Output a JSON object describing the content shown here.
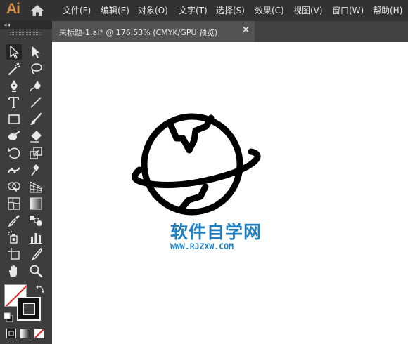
{
  "app": {
    "logo_text": "Ai",
    "brand_color": "#d48e47"
  },
  "menu": {
    "items": [
      {
        "label": "文件(F)"
      },
      {
        "label": "编辑(E)"
      },
      {
        "label": "对象(O)"
      },
      {
        "label": "文字(T)"
      },
      {
        "label": "选择(S)"
      },
      {
        "label": "效果(C)"
      },
      {
        "label": "视图(V)"
      },
      {
        "label": "窗口(W)"
      },
      {
        "label": "帮助(H)"
      }
    ]
  },
  "panel": {
    "collapse_glyph": "◂◂"
  },
  "toolbar": {
    "tools": [
      {
        "name": "selection-tool-icon",
        "active": true
      },
      {
        "name": "direct-selection-tool-icon"
      },
      {
        "name": "magic-wand-tool-icon"
      },
      {
        "name": "lasso-tool-icon"
      },
      {
        "name": "pen-tool-icon"
      },
      {
        "name": "curvature-tool-icon"
      },
      {
        "name": "type-tool-icon"
      },
      {
        "name": "line-segment-tool-icon"
      },
      {
        "name": "rectangle-tool-icon"
      },
      {
        "name": "paintbrush-tool-icon"
      },
      {
        "name": "shaper-tool-icon"
      },
      {
        "name": "eraser-tool-icon"
      },
      {
        "name": "rotate-tool-icon"
      },
      {
        "name": "scale-tool-icon"
      },
      {
        "name": "width-tool-icon"
      },
      {
        "name": "puppet-warp-tool-icon"
      },
      {
        "name": "shape-builder-tool-icon"
      },
      {
        "name": "perspective-grid-tool-icon"
      },
      {
        "name": "mesh-tool-icon"
      },
      {
        "name": "gradient-tool-icon"
      },
      {
        "name": "eyedropper-tool-icon"
      },
      {
        "name": "blend-tool-icon"
      },
      {
        "name": "symbol-sprayer-tool-icon"
      },
      {
        "name": "column-graph-tool-icon"
      },
      {
        "name": "artboard-tool-icon"
      },
      {
        "name": "slice-tool-icon"
      },
      {
        "name": "hand-tool-icon"
      },
      {
        "name": "zoom-tool-icon"
      }
    ],
    "fill_color": "#ffffff",
    "stroke_color": "#111111",
    "none_indicator_color": "#e02020"
  },
  "document": {
    "tab_title": "未标题-1.ai* @ 176.53% (CMYK/GPU 预览)",
    "close_glyph": "×",
    "zoom_percent": 176.53,
    "color_mode": "CMYK",
    "preview_mode": "GPU 预览"
  },
  "watermark": {
    "title": "软件自学网",
    "url": "WWW.RJZXW.COM",
    "color": "#1e7fc0"
  }
}
